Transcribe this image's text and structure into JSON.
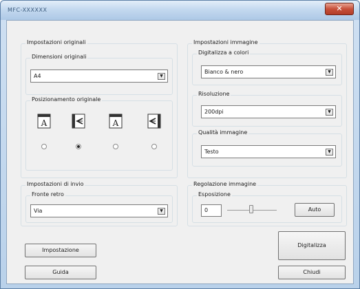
{
  "window": {
    "title": "MFC-XXXXXX",
    "close_glyph": "✕"
  },
  "original": {
    "group_label": "Impostazioni originali",
    "size": {
      "label": "Dimensioni originali",
      "value": "A4"
    },
    "placement": {
      "label": "Posizionamento originale",
      "options": [
        {
          "icon": "portrait-letter-a-icon",
          "selected": false
        },
        {
          "icon": "landscape-left-icon",
          "selected": true
        },
        {
          "icon": "portrait-letter-a-rotated-icon",
          "selected": false
        },
        {
          "icon": "landscape-right-icon",
          "selected": false
        }
      ]
    }
  },
  "send": {
    "group_label": "Impostazioni di invio",
    "duplex": {
      "label": "Fronte retro",
      "value": "Via"
    }
  },
  "image": {
    "group_label": "Impostazioni immagine",
    "color": {
      "label": "Digitalizza a colori",
      "value": "Bianco & nero"
    },
    "resolution": {
      "label": "Risoluzione",
      "value": "200dpi"
    },
    "quality": {
      "label": "Qualità immagine",
      "value": "Testo"
    }
  },
  "adjust": {
    "group_label": "Regolazione immagine",
    "exposure": {
      "label": "Esposizione",
      "value": "0",
      "auto_label": "Auto"
    }
  },
  "buttons": {
    "settings": "Impostazione",
    "scan": "Digitalizza",
    "help": "Guida",
    "close": "Chiudi"
  }
}
